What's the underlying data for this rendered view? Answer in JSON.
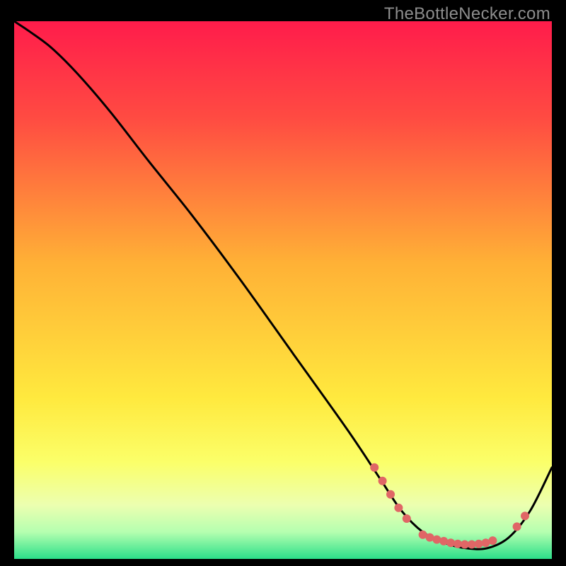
{
  "watermark": "TheBottleNecker.com",
  "chart_data": {
    "type": "line",
    "title": "",
    "xlabel": "",
    "ylabel": "",
    "xlim": [
      0,
      100
    ],
    "ylim": [
      0,
      100
    ],
    "grid": false,
    "legend": false,
    "background_gradient": {
      "stops": [
        {
          "offset": 0.0,
          "color": "#ff1c4b"
        },
        {
          "offset": 0.18,
          "color": "#ff4b42"
        },
        {
          "offset": 0.45,
          "color": "#ffb136"
        },
        {
          "offset": 0.7,
          "color": "#ffe93e"
        },
        {
          "offset": 0.82,
          "color": "#fbff69"
        },
        {
          "offset": 0.9,
          "color": "#ecffb0"
        },
        {
          "offset": 0.95,
          "color": "#b5ffb0"
        },
        {
          "offset": 1.0,
          "color": "#2bdf8a"
        }
      ]
    },
    "series": [
      {
        "name": "curve",
        "color": "#000000",
        "x": [
          0,
          3,
          7,
          12,
          18,
          25,
          33,
          42,
          52,
          62,
          68,
          72,
          76,
          80,
          84,
          88,
          92,
          96,
          100
        ],
        "y": [
          100,
          98,
          95,
          90,
          83,
          74,
          64,
          52,
          38,
          24,
          15,
          9,
          5,
          3,
          2,
          2,
          4,
          9,
          17
        ]
      }
    ],
    "markers": {
      "name": "highlight-dots",
      "color": "#e06666",
      "radius": 6,
      "points": [
        {
          "x": 67.0,
          "y": 17.0
        },
        {
          "x": 68.5,
          "y": 14.5
        },
        {
          "x": 70.0,
          "y": 12.0
        },
        {
          "x": 71.5,
          "y": 9.5
        },
        {
          "x": 73.0,
          "y": 7.5
        },
        {
          "x": 76.0,
          "y": 4.5
        },
        {
          "x": 77.3,
          "y": 4.0
        },
        {
          "x": 78.6,
          "y": 3.6
        },
        {
          "x": 79.9,
          "y": 3.3
        },
        {
          "x": 81.2,
          "y": 3.0
        },
        {
          "x": 82.5,
          "y": 2.8
        },
        {
          "x": 83.8,
          "y": 2.7
        },
        {
          "x": 85.1,
          "y": 2.7
        },
        {
          "x": 86.4,
          "y": 2.8
        },
        {
          "x": 87.7,
          "y": 3.0
        },
        {
          "x": 89.0,
          "y": 3.4
        },
        {
          "x": 93.5,
          "y": 6.0
        },
        {
          "x": 95.0,
          "y": 8.0
        }
      ]
    }
  }
}
